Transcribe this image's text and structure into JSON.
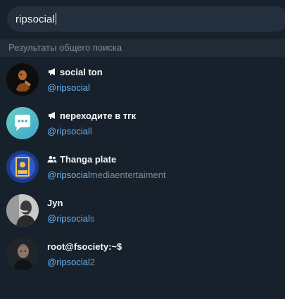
{
  "search": {
    "query": "ripsocial"
  },
  "section": {
    "title": "Результаты общего поиска"
  },
  "colors": {
    "background": "#17212b",
    "search_box": "#242f3d",
    "section_bg": "#202b36",
    "highlight": "#6ab3f3",
    "muted": "#7f8b96"
  },
  "results": [
    {
      "icon": "megaphone-icon",
      "title": "social ton",
      "username_match": "@ripsocial",
      "username_rest": ""
    },
    {
      "icon": "megaphone-icon",
      "title": "переходите в тгк",
      "username_match": "@ripsocial",
      "username_rest": "l"
    },
    {
      "icon": "group-icon",
      "title": "Thanga plate",
      "username_match": "@ripsocial",
      "username_rest": "mediaentertaiment"
    },
    {
      "icon": "",
      "title": "Jyn",
      "username_match": "@ripsocial",
      "username_rest": "s"
    },
    {
      "icon": "",
      "title": "root@fsociety:~$",
      "username_match": "@ripsocial",
      "username_rest": "2"
    }
  ]
}
